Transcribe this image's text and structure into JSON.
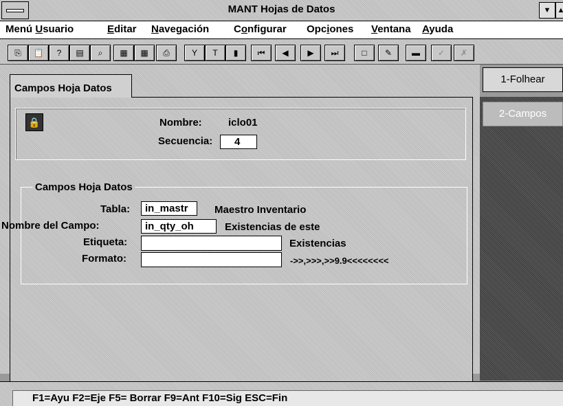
{
  "window": {
    "title": "MANT Hojas de Datos"
  },
  "menu": [
    {
      "pre": "Menú ",
      "ul": "U",
      "post": "suario"
    },
    {
      "pre": "",
      "ul": "E",
      "post": "ditar"
    },
    {
      "pre": "",
      "ul": "N",
      "post": "avegación"
    },
    {
      "pre": "C",
      "ul": "o",
      "post": "nfigurar"
    },
    {
      "pre": "Opc",
      "ul": "i",
      "post": "ones"
    },
    {
      "pre": "",
      "ul": "V",
      "post": "entana"
    },
    {
      "pre": "",
      "ul": "A",
      "post": "yuda"
    }
  ],
  "toolbar": {
    "buttons": [
      {
        "name": "copy-icon",
        "glyph": "⎘"
      },
      {
        "name": "paste-icon",
        "glyph": "📋"
      },
      {
        "name": "help-query-icon",
        "glyph": "?"
      },
      {
        "name": "notes-icon",
        "glyph": "▤"
      },
      {
        "name": "zoom-icon",
        "glyph": "⌕"
      },
      {
        "name": "calculator-icon",
        "glyph": "▦"
      },
      {
        "name": "grid-icon",
        "glyph": "▦"
      },
      {
        "name": "print-icon",
        "glyph": "⎙"
      },
      {
        "name": "filter-icon",
        "glyph": "Y"
      },
      {
        "name": "text-icon",
        "glyph": "T"
      },
      {
        "name": "chart-icon",
        "glyph": "▮"
      },
      {
        "name": "first-record-icon",
        "glyph": "⏮"
      },
      {
        "name": "prev-record-icon",
        "glyph": "◀"
      },
      {
        "name": "next-record-icon",
        "glyph": "▶"
      },
      {
        "name": "last-record-icon",
        "glyph": "⏭"
      },
      {
        "name": "new-icon",
        "glyph": "□"
      },
      {
        "name": "edit-icon",
        "glyph": "✎"
      },
      {
        "name": "delete-icon",
        "glyph": "▬"
      },
      {
        "name": "accept-icon",
        "glyph": "✓"
      },
      {
        "name": "cancel-icon",
        "glyph": "✗"
      }
    ]
  },
  "tab": {
    "label": "Campos Hoja Datos"
  },
  "header": {
    "nombre_label": "Nombre:",
    "nombre_value": "iclo01",
    "secuencia_label": "Secuencia:",
    "secuencia_value": "4"
  },
  "group": {
    "title": "Campos Hoja Datos",
    "tabla_label": "Tabla:",
    "tabla_value": "in_mastr",
    "tabla_desc": "Maestro Inventario",
    "campo_label": "Nombre del Campo:",
    "campo_value": "in_qty_oh",
    "campo_desc": "Existencias de este",
    "etiqueta_label": "Etiqueta:",
    "etiqueta_value": "",
    "etiqueta_desc": "Existencias",
    "formato_label": "Formato:",
    "formato_value": "",
    "formato_desc": "->>,>>>,>>9.9<<<<<<<<"
  },
  "side": {
    "folhear": "1-Folhear",
    "campos": "2-Campos"
  },
  "status": {
    "text": "F1=Ayu  F2=Eje  F5= Borrar  F9=Ant  F10=Sig  ESC=Fin"
  }
}
